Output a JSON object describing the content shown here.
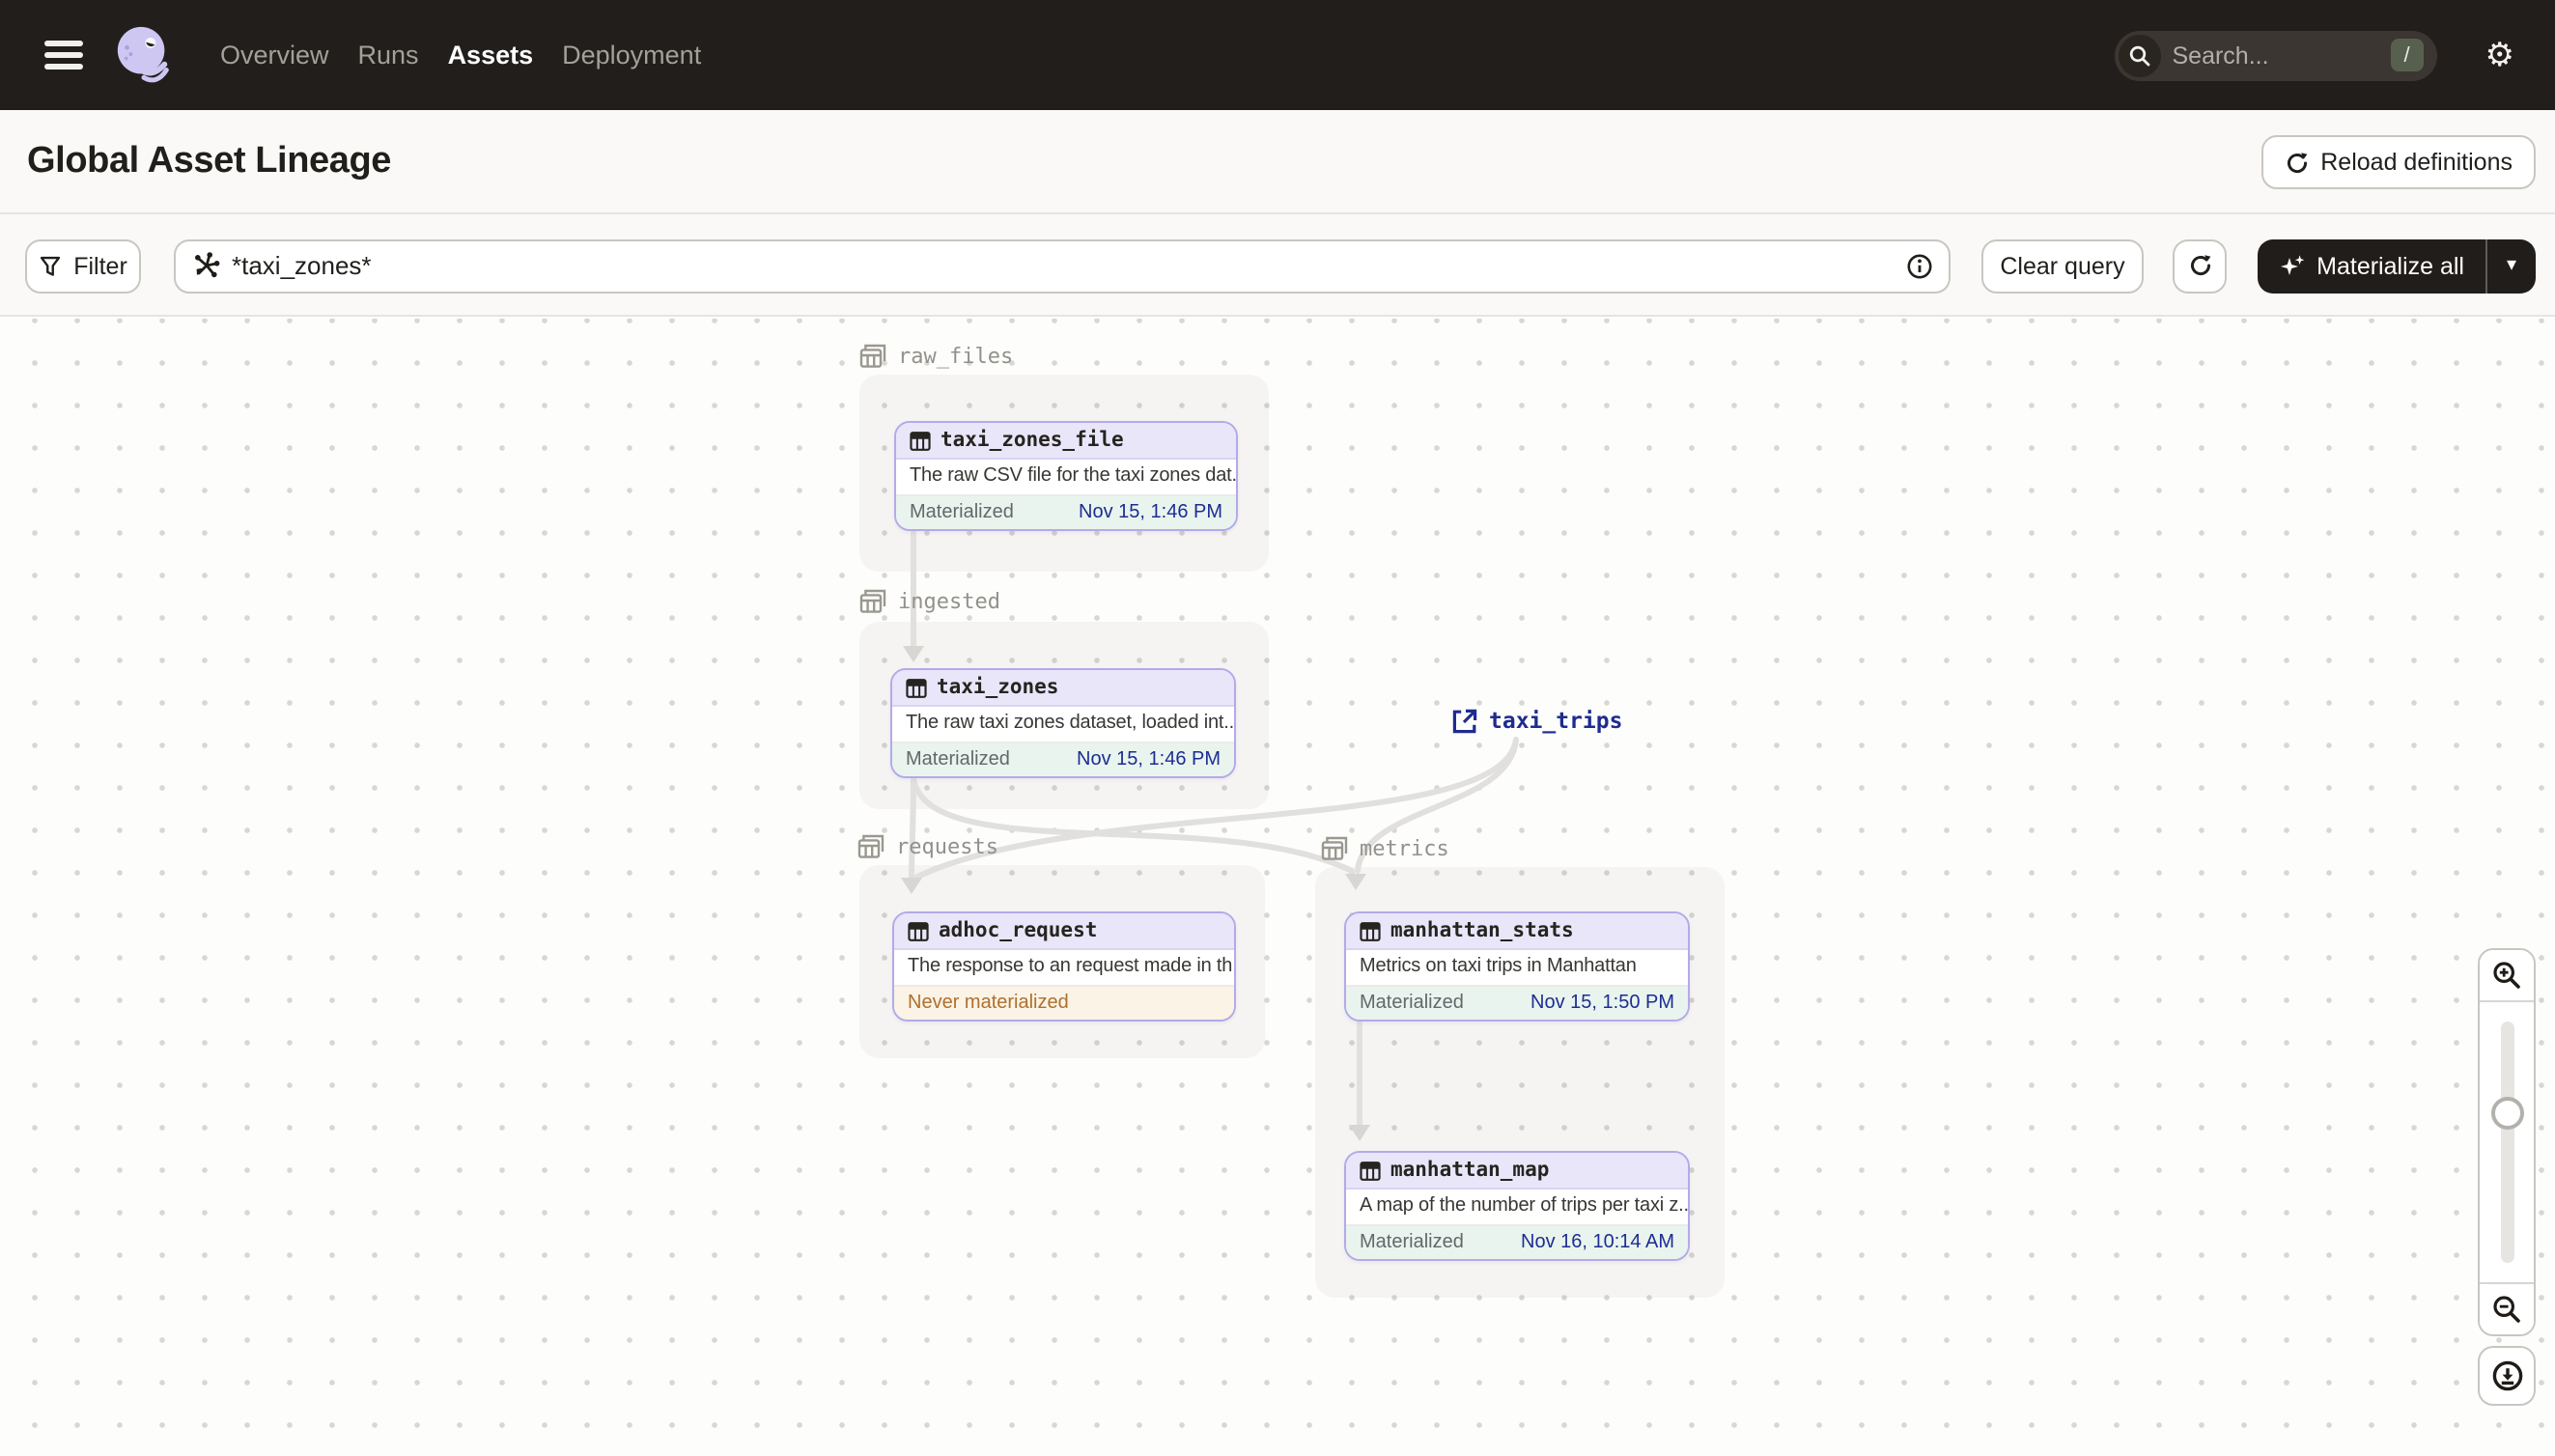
{
  "nav": {
    "items": [
      {
        "label": "Overview",
        "active": false
      },
      {
        "label": "Runs",
        "active": false
      },
      {
        "label": "Assets",
        "active": true
      },
      {
        "label": "Deployment",
        "active": false
      }
    ],
    "search_placeholder": "Search...",
    "search_shortcut": "/"
  },
  "header": {
    "title": "Global Asset Lineage",
    "reload_label": "Reload definitions"
  },
  "toolbar": {
    "filter_label": "Filter",
    "query_value": "*taxi_zones*",
    "clear_label": "Clear query",
    "materialize_label": "Materialize all"
  },
  "graph": {
    "groups": {
      "raw_files": {
        "label": "raw_files"
      },
      "ingested": {
        "label": "ingested"
      },
      "requests": {
        "label": "requests"
      },
      "metrics": {
        "label": "metrics"
      }
    },
    "nodes": {
      "taxi_zones_file": {
        "name": "taxi_zones_file",
        "description": "The raw CSV file for the taxi zones dat...",
        "status": "Materialized",
        "time": "Nov 15, 1:46 PM"
      },
      "taxi_zones": {
        "name": "taxi_zones",
        "description": "The raw taxi zones dataset, loaded int...",
        "status": "Materialized",
        "time": "Nov 15, 1:46 PM"
      },
      "adhoc_request": {
        "name": "adhoc_request",
        "description": "The response to an request made in th...",
        "status": "Never materialized",
        "time": ""
      },
      "manhattan_stats": {
        "name": "manhattan_stats",
        "description": "Metrics on taxi trips in Manhattan",
        "status": "Materialized",
        "time": "Nov 15, 1:50 PM"
      },
      "manhattan_map": {
        "name": "manhattan_map",
        "description": "A map of the number of trips per taxi z...",
        "status": "Materialized",
        "time": "Nov 16, 10:14 AM"
      }
    },
    "external_assets": {
      "taxi_trips": {
        "name": "taxi_trips"
      }
    },
    "edges": [
      {
        "from": "taxi_zones_file",
        "to": "taxi_zones"
      },
      {
        "from": "taxi_zones",
        "to": "adhoc_request"
      },
      {
        "from": "taxi_zones",
        "to": "manhattan_stats"
      },
      {
        "from": "taxi_trips",
        "to": "adhoc_request"
      },
      {
        "from": "taxi_trips",
        "to": "manhattan_stats"
      },
      {
        "from": "manhattan_stats",
        "to": "manhattan_map"
      }
    ]
  },
  "colors": {
    "nav_bg": "#221e1b",
    "node_border": "#b3aae9",
    "node_header_bg": "#e9e6f9",
    "materialized_bg": "#e9f4ee",
    "timestamp_text": "#1d2d92",
    "never_materialized_bg": "#faf3e6",
    "never_materialized_text": "#b06f2d",
    "edge": "#e1e0de"
  }
}
